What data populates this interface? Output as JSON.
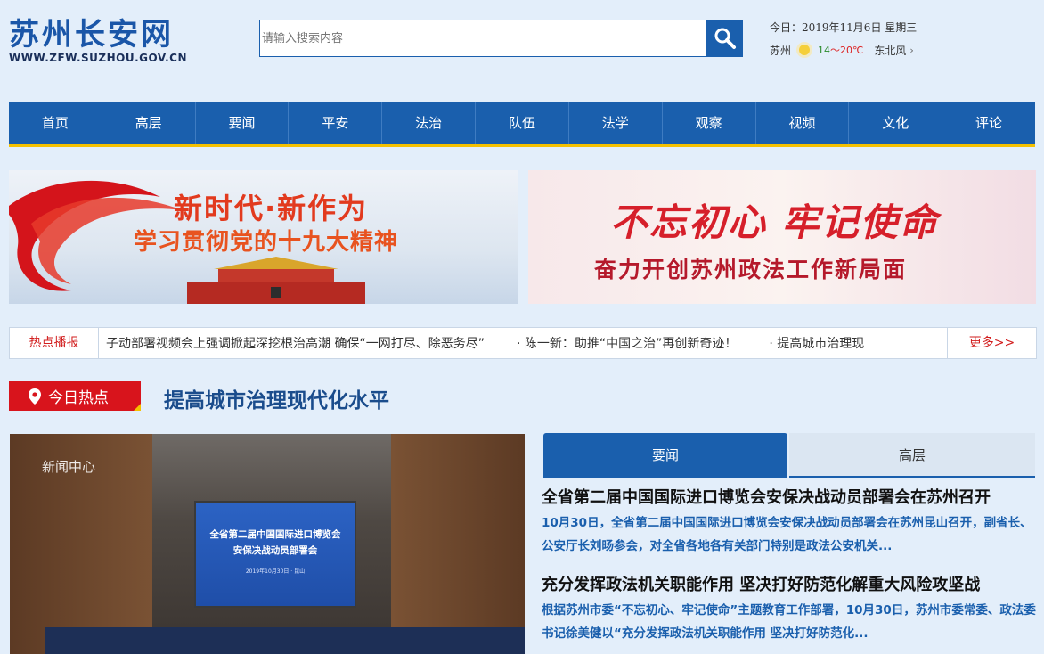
{
  "header": {
    "logo_cn": "苏州长安网",
    "logo_en": "WWW.ZFW.SUZHOU.GOV.CN",
    "search_placeholder": "请输入搜索内容",
    "date": "今日：2019年11月6日  星期三",
    "weather": {
      "city": "苏州",
      "temp_low": "14",
      "temp_sep": "～",
      "temp_high": "20",
      "unit": "℃",
      "wind": "东北风",
      "icon": "sun-icon"
    }
  },
  "nav": [
    "首页",
    "高层",
    "要闻",
    "平安",
    "法治",
    "队伍",
    "法学",
    "观察",
    "视频",
    "文化",
    "评论"
  ],
  "banners": {
    "left_line1": "新时代·新作为",
    "left_line2": "学习贯彻党的十九大精神",
    "right_line1": "不忘初心 牢记使命",
    "right_line2": "奋力开创苏州政法工作新局面"
  },
  "ticker": {
    "label": "热点播报",
    "items": [
      "子动部署视频会上强调掀起深挖根治高潮 确保“一网打尽、除恶务尽”",
      "· 陈一新：助推“中国之治”再创新奇迹！",
      "· 提高城市治理现"
    ],
    "more": "更多>>"
  },
  "today_hot": {
    "label": "今日热点",
    "title": "提高城市治理现代化水平"
  },
  "photo": {
    "caption": "新闻中心",
    "screen_line1": "全省第二届中国国际进口博览会",
    "screen_line2": "安保决战动员部署会",
    "screen_line3": "2019年10月30日 · 昆山"
  },
  "tabs": [
    "要闻",
    "高层"
  ],
  "news": [
    {
      "title": "全省第二届中国国际进口博览会安保决战动员部署会在苏州召开",
      "summary": "10月30日，全省第二届中国国际进口博览会安保决战动员部署会在苏州昆山召开，副省长、公安厅长刘旸参会，对全省各地各有关部门特别是政法公安机关..."
    },
    {
      "title": "充分发挥政法机关职能作用 坚决打好防范化解重大风险攻坚战",
      "summary": "根据苏州市委“不忘初心、牢记使命”主题教育工作部署，10月30日，苏州市委常委、政法委书记徐美健以“充分发挥政法机关职能作用 坚决打好防范化..."
    }
  ],
  "colors": {
    "primary": "#1a5fad",
    "accent_red": "#d8141c",
    "accent_yellow": "#f5c100",
    "background": "#e3eefa"
  }
}
